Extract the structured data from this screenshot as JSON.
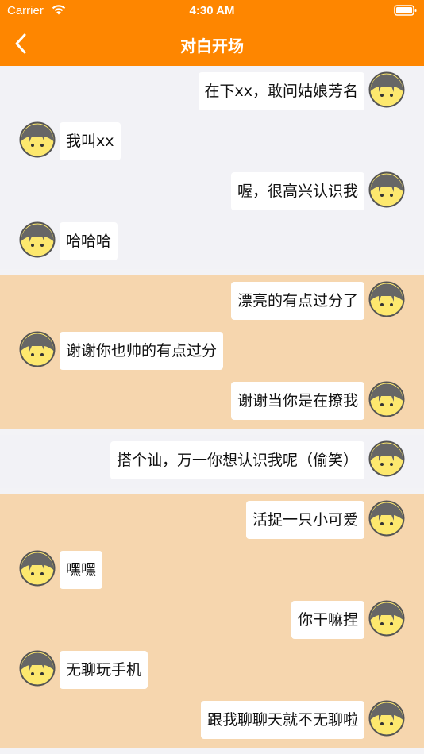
{
  "status_bar": {
    "carrier": "Carrier",
    "time": "4:30 AM"
  },
  "nav": {
    "title": "对白开场",
    "back_icon": "chevron-left-icon"
  },
  "colors": {
    "accent": "#fe8600",
    "section_light": "#f2f2f6",
    "section_tan": "#f6d6ae",
    "bubble": "#ffffff"
  },
  "sections": [
    {
      "background": "light",
      "messages": [
        {
          "side": "right",
          "text": "在下xx，敢问姑娘芳名"
        },
        {
          "side": "left",
          "text": "我叫xx"
        },
        {
          "side": "right",
          "text": "喔，很高兴认识我"
        },
        {
          "side": "left",
          "text": "哈哈哈"
        }
      ]
    },
    {
      "background": "tan",
      "messages": [
        {
          "side": "right",
          "text": "漂亮的有点过分了"
        },
        {
          "side": "left",
          "text": "谢谢你也帅的有点过分"
        },
        {
          "side": "right",
          "text": "谢谢当你是在撩我"
        }
      ]
    },
    {
      "background": "light",
      "messages": [
        {
          "side": "right",
          "text": "搭个讪，万一你想认识我呢（偷笑）"
        }
      ]
    },
    {
      "background": "tan",
      "messages": [
        {
          "side": "right",
          "text": "活捉一只小可爱"
        },
        {
          "side": "left",
          "text": "嘿嘿"
        },
        {
          "side": "right",
          "text": "你干嘛捏"
        },
        {
          "side": "left",
          "text": "无聊玩手机"
        },
        {
          "side": "right",
          "text": "跟我聊聊天就不无聊啦"
        }
      ]
    }
  ]
}
